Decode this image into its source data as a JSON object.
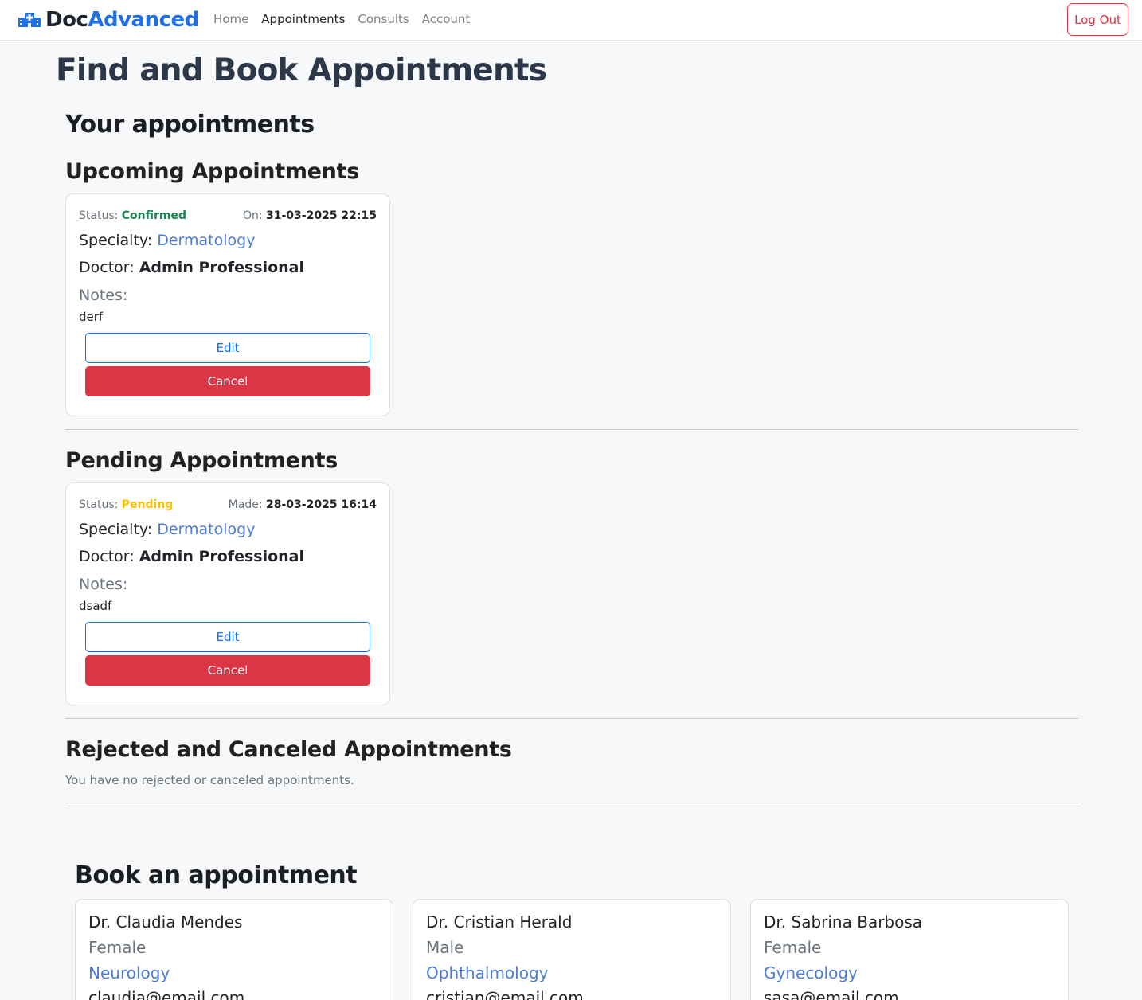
{
  "nav": {
    "brand_doc": "Doc",
    "brand_adv": "Advanced",
    "links": [
      "Home",
      "Appointments",
      "Consults",
      "Account"
    ],
    "logout": "Log Out"
  },
  "page": {
    "title": "Find and Book Appointments",
    "your_appointments": "Your appointments"
  },
  "upcoming": {
    "heading": "Upcoming Appointments",
    "status_label": "Status:",
    "status": "Confirmed",
    "date_label": "On:",
    "date": "31-03-2025 22:15",
    "specialty_label": "Specialty:",
    "specialty": "Dermatology",
    "doctor_label": "Doctor:",
    "doctor": "Admin Professional",
    "notes_label": "Notes:",
    "notes": "derf",
    "edit": "Edit",
    "cancel": "Cancel"
  },
  "pending": {
    "heading": "Pending Appointments",
    "status_label": "Status:",
    "status": "Pending",
    "date_label": "Made:",
    "date": "28-03-2025 16:14",
    "specialty_label": "Specialty:",
    "specialty": "Dermatology",
    "doctor_label": "Doctor:",
    "doctor": "Admin Professional",
    "notes_label": "Notes:",
    "notes": "dsadf",
    "edit": "Edit",
    "cancel": "Cancel"
  },
  "rejected": {
    "heading": "Rejected and Canceled Appointments",
    "empty": "You have no rejected or canceled appointments."
  },
  "book": {
    "heading": "Book an appointment",
    "doctors": [
      {
        "name": "Dr. Claudia Mendes",
        "gender": "Female",
        "specialty": "Neurology",
        "email": "claudia@email.com"
      },
      {
        "name": "Dr. Cristian Herald",
        "gender": "Male",
        "specialty": "Ophthalmology",
        "email": "cristian@email.com"
      },
      {
        "name": "Dr. Sabrina Barbosa",
        "gender": "Female",
        "specialty": "Gynecology",
        "email": "sasa@email.com"
      }
    ]
  },
  "colors": {
    "accent": "#1f6fe5",
    "danger": "#dc3545",
    "success": "#198754",
    "warning": "#ffc107",
    "link": "#4d7cd6"
  },
  "icons": {
    "brand": "hospital-icon"
  }
}
